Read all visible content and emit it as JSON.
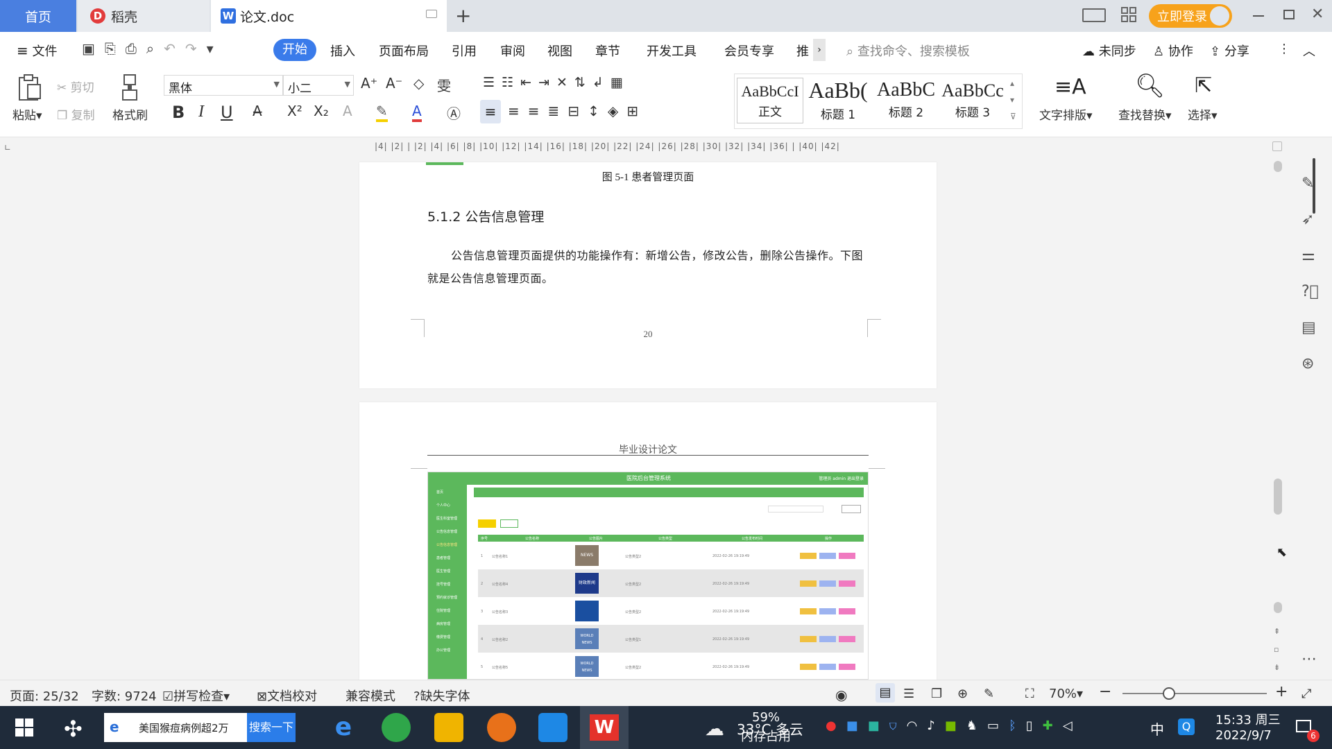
{
  "titlebar": {
    "tabs": [
      {
        "label": "首页"
      },
      {
        "label": "稻壳"
      },
      {
        "label": "论文.doc"
      }
    ],
    "new_tab": "+",
    "login": "立即登录",
    "window_controls": [
      "minimize-icon",
      "restore-icon",
      "close-icon"
    ]
  },
  "menubar": {
    "file": "文件",
    "items": [
      "开始",
      "插入",
      "页面布局",
      "引用",
      "审阅",
      "视图",
      "章节",
      "开发工具",
      "会员专享",
      "推"
    ],
    "search_placeholder": "查找命令、搜索模板",
    "sync": "未同步",
    "collab": "协作",
    "share": "分享"
  },
  "ribbon": {
    "paste": "粘贴",
    "cut": "剪切",
    "copy": "复制",
    "format_painter": "格式刷",
    "font_name": "黑体",
    "font_size": "小二",
    "styles": [
      {
        "sample": "AaBbCcI",
        "name": "正文"
      },
      {
        "sample": "AaBb(",
        "name": "标题 1"
      },
      {
        "sample": "AaBbC",
        "name": "标题 2"
      },
      {
        "sample": "AaBbCc",
        "name": "标题 3"
      }
    ],
    "text_layout": "文字排版",
    "find_replace": "查找替换",
    "select": "选择"
  },
  "ruler": {
    "ticks": "|4| |2| |  |2| |4| |6| |8| |10| |12| |14| |16| |18| |20| |22| |24| |26| |28| |30| |32| |34| |36| |  |40| |42|"
  },
  "document": {
    "figure_caption": "图 5-1  患者管理页面",
    "section_heading": "5.1.2  公告信息管理",
    "paragraph": "公告信息管理页面提供的功能操作有：新增公告，修改公告，删除公告操作。下图就是公告信息管理页面。",
    "page_number": "20",
    "page2_header": "毕业设计论文",
    "mock_app": {
      "title": "医院后台管理系统",
      "user": "管理员 admin    退出登录",
      "sidebar": [
        "首页",
        "个人中心",
        "医生科室管理",
        "公告信息管理",
        "公告信息管理",
        "患者管理",
        "医生管理",
        "挂号管理",
        "预约就诊管理",
        "住院管理",
        "病房管理",
        "缴费管理",
        "办公管理"
      ],
      "columns": [
        "序号",
        "公告名称",
        "公告图片",
        "公告类型",
        "公告发布时间",
        "操作"
      ],
      "rows": [
        {
          "idx": "1",
          "name": "公告名称1",
          "img": "NEWS",
          "type": "公告类型2",
          "time": "2022-02-26 19:19:49"
        },
        {
          "idx": "2",
          "name": "公告名称4",
          "img": "财政新闻",
          "type": "公告类型2",
          "time": "2022-02-26 19:19:49"
        },
        {
          "idx": "3",
          "name": "公告名称3",
          "img": "",
          "type": "公告类型2",
          "time": "2022-02-26 19:19:49"
        },
        {
          "idx": "4",
          "name": "公告名称2",
          "img": "WORLD NEWS",
          "type": "公告类型1",
          "time": "2022-02-26 19:19:49"
        },
        {
          "idx": "5",
          "name": "公告名称5",
          "img": "WORLD NEWS",
          "type": "公告类型2",
          "time": "2022-02-26 19:19:49"
        }
      ]
    }
  },
  "statusbar": {
    "page": "页面: 25/32",
    "words": "字数: 9724",
    "spell": "拼写检查",
    "proof": "文档校对",
    "compat": "兼容模式",
    "missing_font": "缺失字体",
    "zoom": "70%"
  },
  "taskbar": {
    "search_text": "美国猴痘病例超2万",
    "search_button": "搜索一下",
    "weather": "33°C  多云",
    "memory": "59%",
    "memory_label": "内存占用",
    "ime": "中",
    "time": "15:33 周三",
    "date": "2022/9/7",
    "notif_count": "6"
  },
  "colors": {
    "accent": "#3a7bea",
    "login": "#f7a21b",
    "mock_green": "#5cb85c",
    "taskbar": "#1f2b3a"
  }
}
